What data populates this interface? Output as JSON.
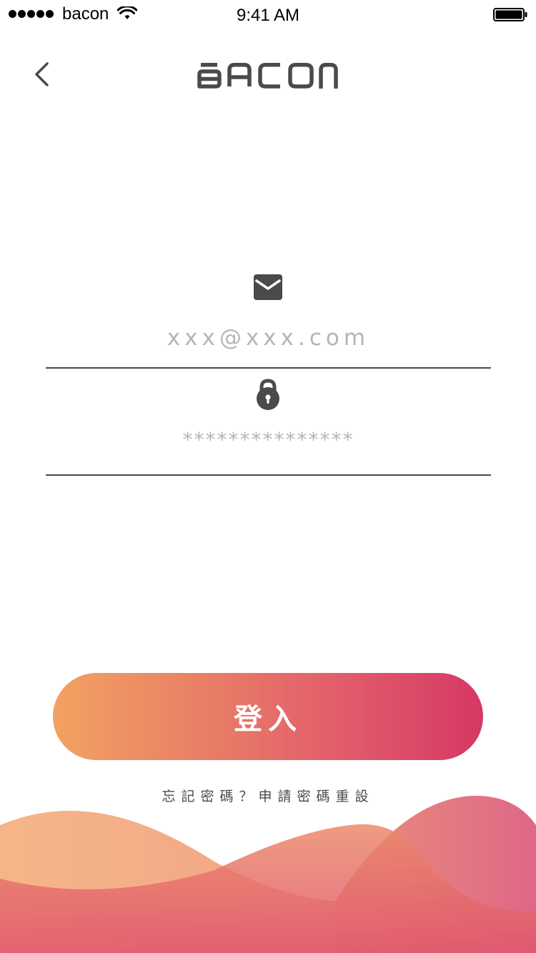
{
  "status_bar": {
    "carrier": "bacon",
    "time": "9:41 AM"
  },
  "header": {
    "logo_text": "BACON",
    "back_icon": "chevron-left-icon"
  },
  "form": {
    "email": {
      "icon": "envelope-icon",
      "placeholder": "xxx@xxx.com",
      "value": ""
    },
    "password": {
      "icon": "lock-icon",
      "placeholder": "***************",
      "value": ""
    }
  },
  "login_button": {
    "label": "登入"
  },
  "forgot_password": {
    "text": "忘記密碼？申請密碼重設"
  },
  "colors": {
    "button_gradient_start": "#f2a262",
    "button_gradient_end": "#d63864",
    "text_dark": "#4a4a4a",
    "placeholder": "#b5b5b5",
    "wave_orange": "#f2a262",
    "wave_pink": "#dc5579"
  }
}
